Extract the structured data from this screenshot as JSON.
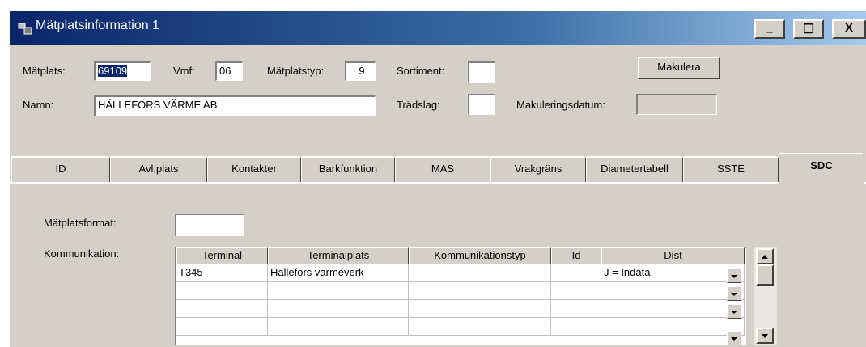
{
  "window": {
    "title": "Mätplatsinformation 1",
    "minimize": "_",
    "maximize": "☐",
    "close": "X"
  },
  "form": {
    "matplats_label": "Mätplats:",
    "matplats_value": "69109",
    "vmf_label": "Vmf:",
    "vmf_value": "06",
    "matplatstyp_label": "Mätplatstyp:",
    "matplatstyp_value": "9",
    "sortiment_label": "Sortiment:",
    "sortiment_value": "",
    "makulera_button": "Makulera",
    "namn_label": "Namn:",
    "namn_value": "HÄLLEFORS VÄRME AB",
    "tradslag_label": "Trädslag:",
    "tradslag_value": "",
    "makuleringsdatum_label": "Makuleringsdatum:",
    "makuleringsdatum_value": ""
  },
  "tabs": [
    "ID",
    "Avl.plats",
    "Kontakter",
    "Barkfunktion",
    "MAS",
    "Vrakgräns",
    "Diametertabell",
    "SSTE",
    "SDC"
  ],
  "active_tab": "SDC",
  "sdc": {
    "matplatsformat_label": "Mätplatsformat:",
    "matplatsformat_value": "",
    "kommunikation_label": "Kommunikation:",
    "columns": [
      "Terminal",
      "Terminalplats",
      "Kommunikationstyp",
      "Id",
      "Dist"
    ],
    "rows": [
      [
        "T345",
        "Hällefors värmeverk",
        "",
        "",
        "J = Indata"
      ],
      [
        "",
        "",
        "",
        "",
        ""
      ],
      [
        "",
        "",
        "",
        "",
        ""
      ],
      [
        "",
        "",
        "",
        "",
        ""
      ]
    ]
  }
}
